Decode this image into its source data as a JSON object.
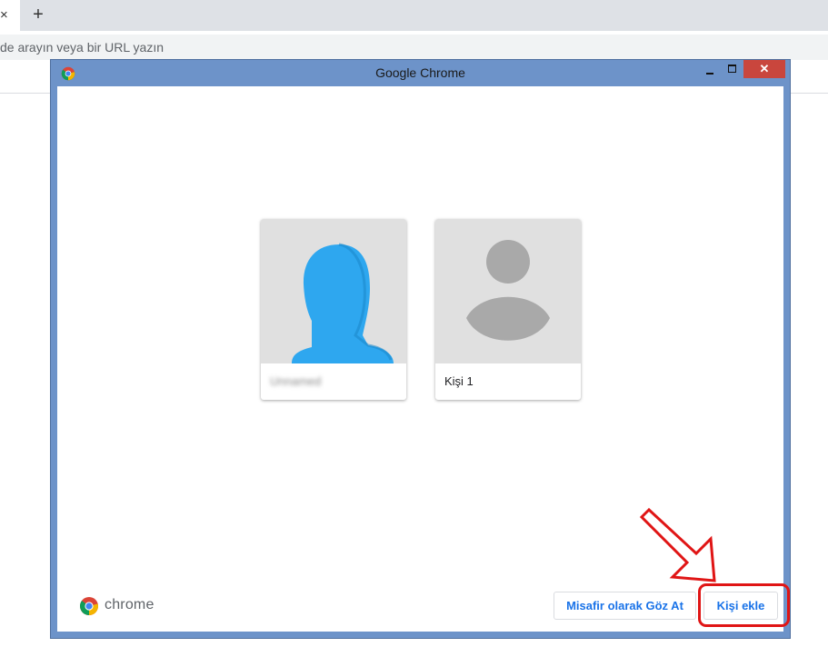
{
  "browser": {
    "tab_close_glyph": "×",
    "new_tab_glyph": "+",
    "omnibox_placeholder": "de arayın veya bir URL yazın"
  },
  "dialog": {
    "title": "Google Chrome",
    "close_glyph": "✕",
    "profiles": [
      {
        "name": "Unnamed",
        "avatar": "blue-silhouette-avatar",
        "blurred": true
      },
      {
        "name": "Kişi 1",
        "avatar": "generic-person-avatar",
        "blurred": false
      }
    ],
    "brand_text": "chrome",
    "guest_button": "Misafir olarak Göz At",
    "add_button": "Kişi ekle"
  },
  "colors": {
    "titlebar": "#6d93c9",
    "close_button": "#c9463d",
    "accent_blue": "#1a73e8",
    "avatar_blue": "#2ea7ef",
    "annotation_red": "#e01515"
  },
  "annotations": {
    "highlight": "red-rounded-box",
    "arrow": "red-arrow-pointing-to-add-button"
  }
}
